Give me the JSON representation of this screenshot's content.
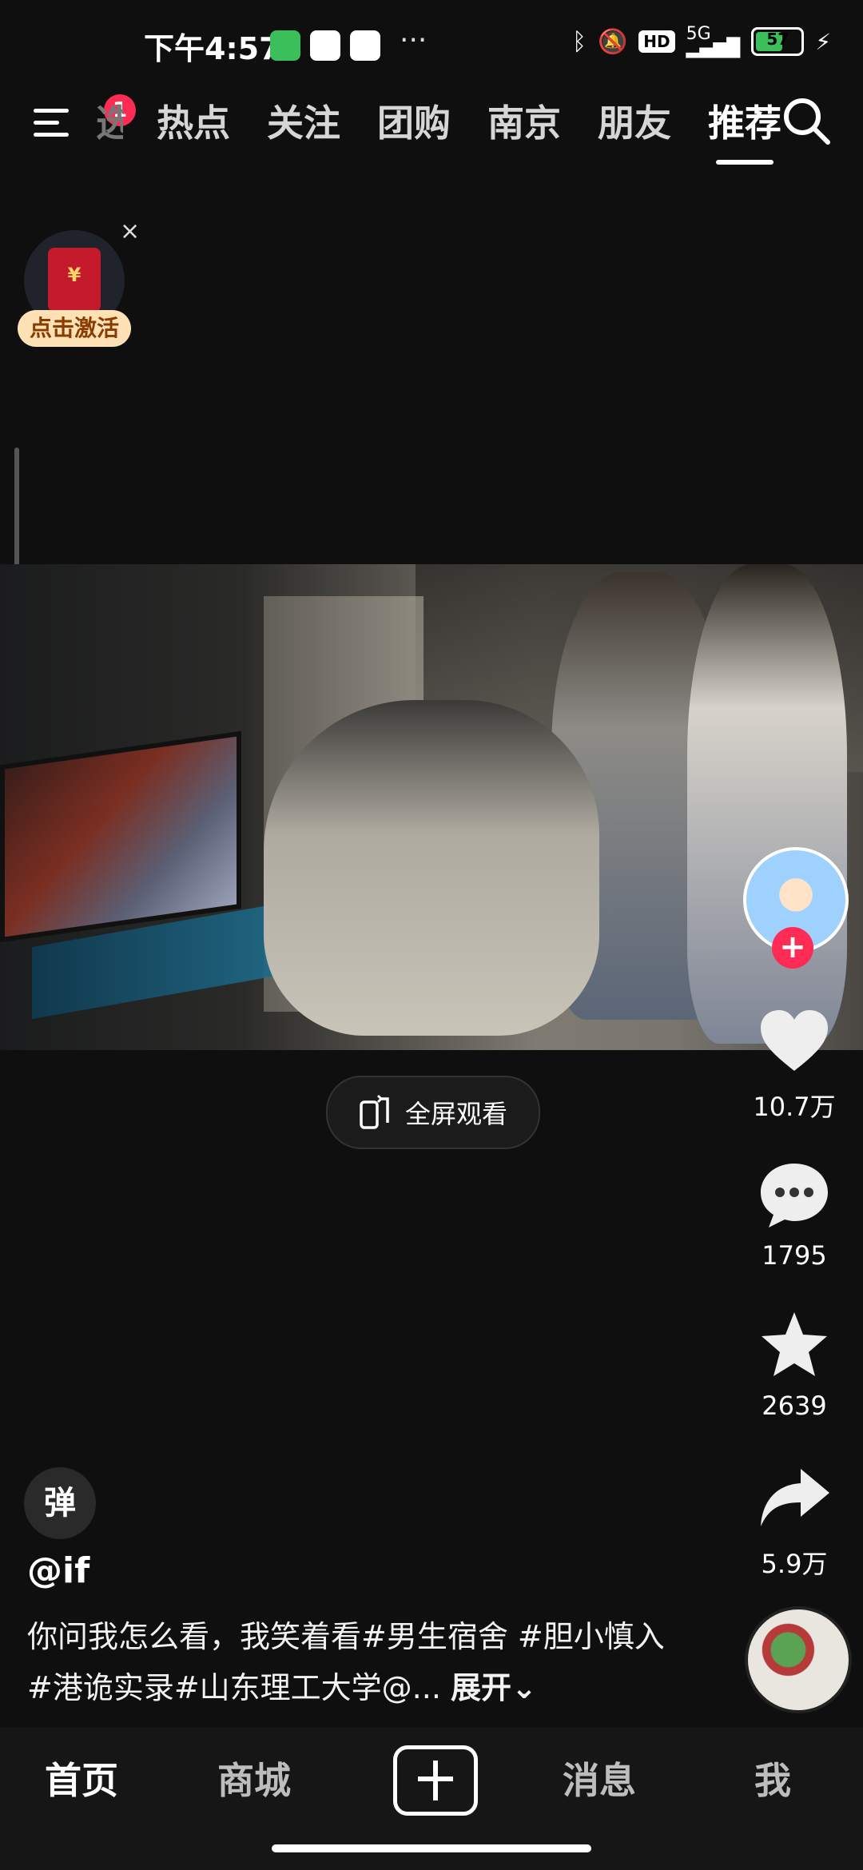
{
  "status": {
    "time": "下午4:57",
    "more": "···",
    "network": "5G",
    "hd_label": "HD",
    "battery": "57"
  },
  "nav": {
    "menu_badge": "1",
    "tabs": [
      "选",
      "热点",
      "关注",
      "团购",
      "南京",
      "朋友",
      "推荐"
    ],
    "active_tab": "推荐"
  },
  "redpack": {
    "label": "点击激活",
    "close": "×"
  },
  "fullscreen": {
    "label": "全屏观看"
  },
  "actions": {
    "likes": "10.7万",
    "comments": "1795",
    "favorites": "2639",
    "shares": "5.9万",
    "follow": "+"
  },
  "post": {
    "danmu_label": "弹",
    "author": "@if",
    "description": "你问我怎么看，我笑着看#男生宿舍 #胆小慎入 #港诡实录#山东理工大学@...",
    "expand": "展开⌄"
  },
  "tabbar": {
    "items": [
      "首页",
      "商城",
      "消息",
      "我"
    ]
  },
  "colors": {
    "accent": "#fe2c55",
    "background": "#0f0f0f"
  }
}
